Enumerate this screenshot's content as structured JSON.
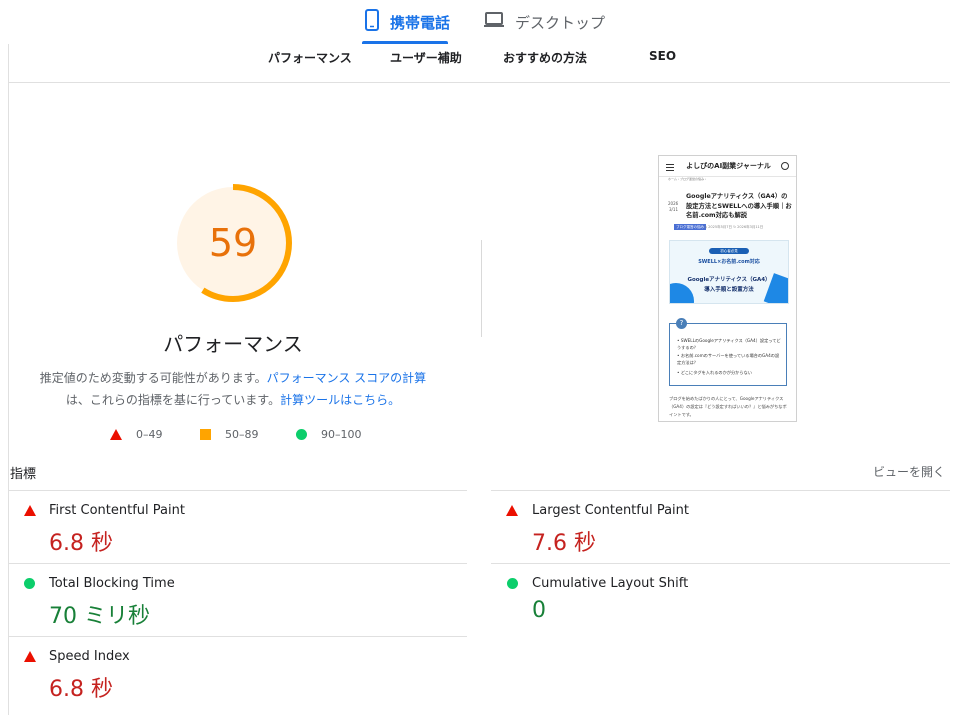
{
  "device_tabs": {
    "mobile": "携帯電話",
    "desktop": "デスクトップ"
  },
  "category_tabs": [
    "パフォーマンス",
    "ユーザー補助",
    "おすすめの方法",
    "SEO"
  ],
  "score": {
    "value": 59,
    "fraction": 0.59,
    "title": "パフォーマンス",
    "color": "#ffa400"
  },
  "description": {
    "part1": "推定値のため変動する可能性があります。",
    "link1": "パフォーマンス スコアの計算",
    "part2": "は、これらの指標を基に行っています。",
    "link2": "計算ツールはこちら。"
  },
  "legend": [
    {
      "range": "0–49",
      "icon": "red-triangle-icon",
      "color": "#eb0f00"
    },
    {
      "range": "50–89",
      "icon": "orange-square-icon",
      "color": "#ffa400"
    },
    {
      "range": "90–100",
      "icon": "green-circle-icon",
      "color": "#0cce6b"
    }
  ],
  "metrics_header": {
    "label": "指標",
    "toggle": "ビューを開く"
  },
  "metrics": {
    "fcp": {
      "title": "First Contentful Paint",
      "value": "6.8 秒",
      "status": "poor"
    },
    "lcp": {
      "title": "Largest Contentful Paint",
      "value": "7.6 秒",
      "status": "poor"
    },
    "tbt": {
      "title": "Total Blocking Time",
      "value": "70 ミリ秒",
      "status": "good"
    },
    "cls": {
      "title": "Cumulative Layout Shift",
      "value": "0",
      "status": "good"
    },
    "si": {
      "title": "Speed Index",
      "value": "6.8 秒",
      "status": "poor"
    }
  },
  "thumbnail": {
    "site_title": "よしぴのAI副業ジャーナル",
    "breadcrumb": "ホーム › ブログ運営の悩み ›",
    "date_year": "2026",
    "date_day": "3/11",
    "article_title": "Googleアナリティクス（GA4）の設定方法とSWELLへの導入手順｜お名前.com対応も解説",
    "category_badge": "ブログ運営の悩み",
    "meta": "◷ 2025年5月7日  ↻ 2026年3月11日",
    "banner_pill": "初心者必見",
    "banner_highlight": "SWELL×お名前.com対応",
    "banner_title_1": "Googleアナリティクス（GA4）",
    "banner_title_2": "導入手順と設置方法",
    "faq_items": [
      "SWELLのGoogleアナリティクス（GA4）設定ってどうするの？",
      "お名前.comのサーバーを使っている場合のGA4の設定方法は？",
      "どこにタグを入れるのかが分からない"
    ],
    "body_text": "ブログを始めたばかりの人にとって、Googleアナリティクス（GA4）の設定は『どう設定すればいいの？』と悩みがちなポイントです。"
  }
}
